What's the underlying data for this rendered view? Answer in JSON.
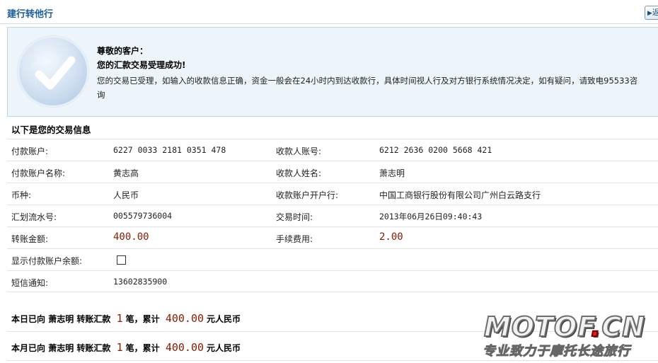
{
  "header": {
    "title": "建行转他行",
    "return_label": "返回"
  },
  "notice": {
    "greeting": "尊敬的客户：",
    "result": "您的汇款交易受理成功!",
    "detail": "您的交易已受理，如输入的收款信息正确，资金一般会在24小时内到达收款行，具体时间视人行及对方银行系统情况决定，如有疑问，请致电95533咨询"
  },
  "section_title": "以下是您的交易信息",
  "info": {
    "payer_account_label": "付款账户:",
    "payer_account": "6227 0033 2181 0351 478",
    "payee_account_label": "收款人账号:",
    "payee_account": "6212 2636 0200 5668 421",
    "payer_name_label": "付款账户名称:",
    "payer_name": "黄志高",
    "payee_name_label": "收款人姓名:",
    "payee_name": "萧志明",
    "currency_label": "币种:",
    "currency": "人民币",
    "payee_bank_label": "收款账户开户行:",
    "payee_bank": "中国工商银行股份有限公司广州白云路支行",
    "serial_label": "汇划流水号:",
    "serial": "005579736004",
    "time_label": "交易时间:",
    "time": "2013年06月26日09:40:43",
    "amount_label": "转账金额:",
    "amount": "400.00",
    "fee_label": "手续费用:",
    "fee": "2.00",
    "show_balance_label": "显示付款账户余额:",
    "show_balance_checked": false,
    "sms_label": "短信通知:",
    "sms": "13602835900"
  },
  "summary_today": {
    "prefix": "本日已向",
    "name": "萧志明",
    "mid": "转账汇款",
    "count": "1",
    "unit": "笔，累计",
    "total": "400.00",
    "suffix": "元人民币"
  },
  "summary_month": {
    "prefix": "本月已向",
    "name": "萧志明",
    "mid": "转账汇款",
    "count": "1",
    "unit": "笔，累计",
    "total": "400.00",
    "suffix": "元人民币"
  },
  "watermark": {
    "logo_main": "MOTOF",
    "logo_dot": ".",
    "logo_tld": "CN",
    "slogan": "专业致力于摩托长途旅行"
  },
  "colors": {
    "title_blue": "#1b5d97",
    "amount_red": "#8b1a00",
    "notice_bg": "#eef5fa"
  },
  "icons": {
    "success": "checkmark-circle-icon",
    "return": "arrow-left-icon"
  }
}
